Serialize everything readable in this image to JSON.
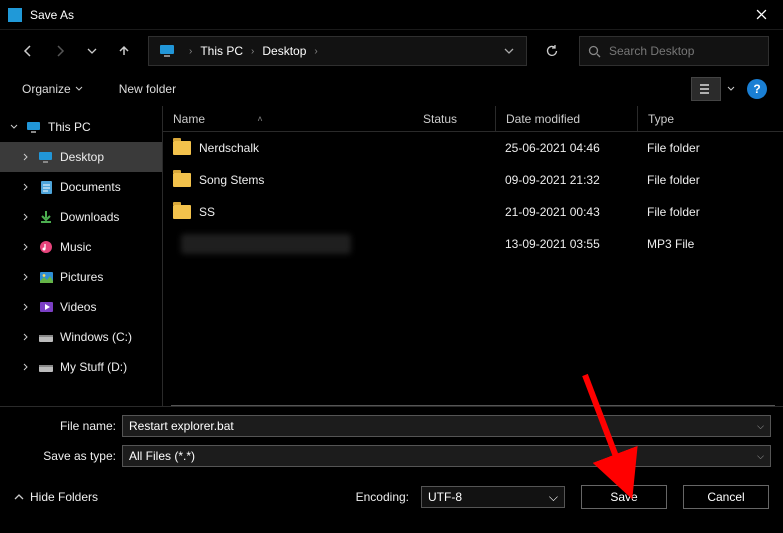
{
  "window": {
    "title": "Save As"
  },
  "breadcrumb": {
    "root": "This PC",
    "folder": "Desktop"
  },
  "search": {
    "placeholder": "Search Desktop"
  },
  "toolbar": {
    "organize": "Organize",
    "new_folder": "New folder"
  },
  "columns": {
    "name": "Name",
    "status": "Status",
    "date": "Date modified",
    "type": "Type"
  },
  "sidebar": {
    "root": "This PC",
    "items": [
      {
        "label": "Desktop"
      },
      {
        "label": "Documents"
      },
      {
        "label": "Downloads"
      },
      {
        "label": "Music"
      },
      {
        "label": "Pictures"
      },
      {
        "label": "Videos"
      },
      {
        "label": "Windows (C:)"
      },
      {
        "label": "My Stuff (D:)"
      }
    ]
  },
  "files": [
    {
      "name": "Nerdschalk",
      "date": "25-06-2021 04:46",
      "type": "File folder",
      "kind": "folder"
    },
    {
      "name": "Song Stems",
      "date": "09-09-2021 21:32",
      "type": "File folder",
      "kind": "folder"
    },
    {
      "name": "SS",
      "date": "21-09-2021 00:43",
      "type": "File folder",
      "kind": "folder"
    },
    {
      "name": "",
      "date": "13-09-2021 03:55",
      "type": "MP3 File",
      "kind": "redacted"
    }
  ],
  "form": {
    "filename_label": "File name:",
    "filename_value": "Restart explorer.bat",
    "type_label": "Save as type:",
    "type_value": "All Files  (*.*)"
  },
  "footer": {
    "hide_folders": "Hide Folders",
    "encoding_label": "Encoding:",
    "encoding_value": "UTF-8",
    "save": "Save",
    "cancel": "Cancel"
  }
}
